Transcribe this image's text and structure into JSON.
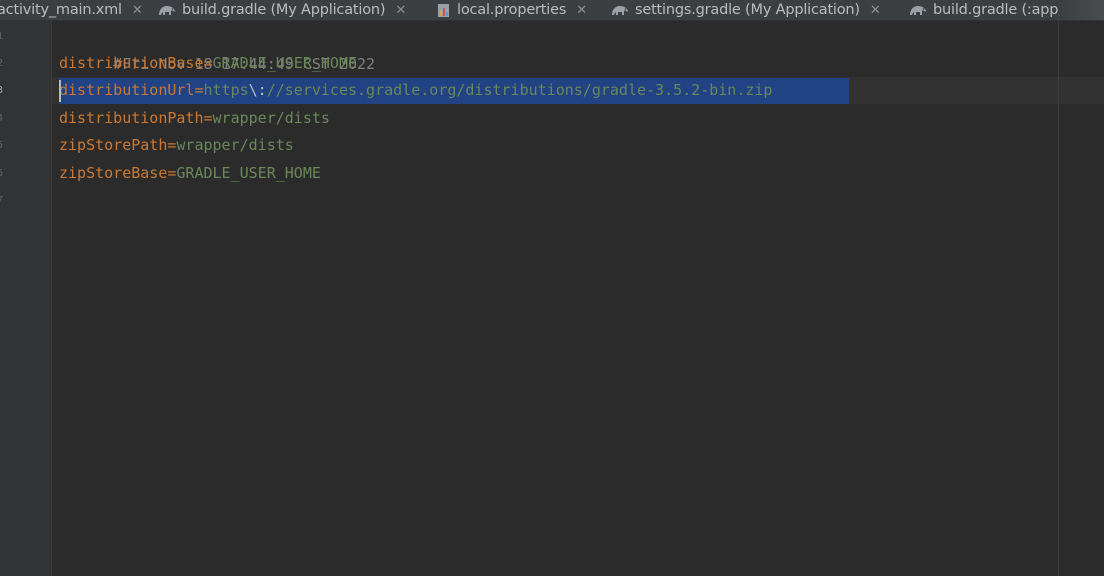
{
  "tabs": [
    {
      "label": "activity_main.xml",
      "icon": "xml-file-icon"
    },
    {
      "label": "build.gradle (My Application)",
      "icon": "gradle-elephant-icon"
    },
    {
      "label": "local.properties",
      "icon": "properties-file-icon"
    },
    {
      "label": "settings.gradle (My Application)",
      "icon": "gradle-elephant-icon"
    },
    {
      "label": "build.gradle (:app)",
      "icon": "gradle-elephant-icon"
    }
  ],
  "close_glyph": "✕",
  "colors": {
    "background": "#2b2b2b",
    "gutter": "#313335",
    "selection": "#214283",
    "key": "#cc7832",
    "value": "#6a8759",
    "comment": "#808080"
  },
  "editor": {
    "line_numbers": [
      "1",
      "2",
      "3",
      "4",
      "5",
      "6",
      "7"
    ],
    "current_line": 3,
    "lines": [
      {
        "comment": "#Fri Nov 18 17:44:49 CST 2022"
      },
      {
        "key": "distributionBase",
        "eq": "=",
        "value": "GRADLE_USER_HOME"
      },
      {
        "key": "distributionUrl",
        "eq": "=",
        "value_a": "https",
        "escape": "\\:",
        "value_b": "//services.gradle.org/distributions/gradle-3.5.2-bin.zip"
      },
      {
        "key": "distributionPath",
        "eq": "=",
        "value": "wrapper/dists"
      },
      {
        "key": "zipStorePath",
        "eq": "=",
        "value": "wrapper/dists"
      },
      {
        "key": "zipStoreBase",
        "eq": "=",
        "value": "GRADLE_USER_HOME"
      }
    ]
  }
}
